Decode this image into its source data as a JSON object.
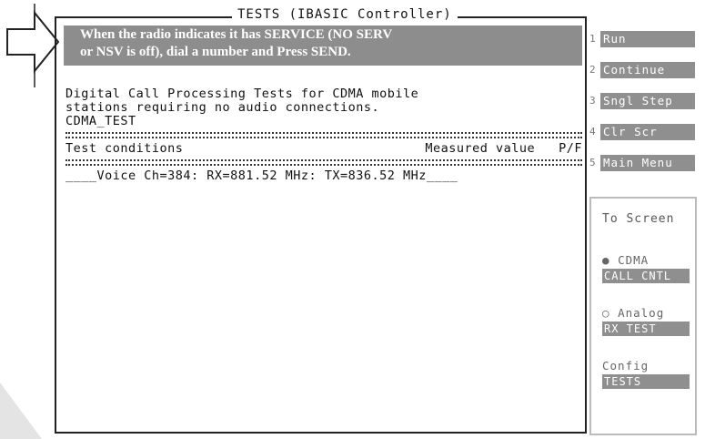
{
  "window": {
    "title": "TESTS (IBASIC Controller)"
  },
  "prompt": {
    "line1": "When the radio indicates it has SERVICE (NO SERV",
    "line2": "or NSV is off), dial a number and Press SEND."
  },
  "output": {
    "desc1": "Digital Call Processing Tests for CDMA mobile",
    "desc2": "stations requiring no audio connections.",
    "test_name": "CDMA_TEST",
    "col_conditions": "Test conditions",
    "col_measured": "Measured value",
    "col_pf": "P/F",
    "result_line": "____Voice Ch=384: RX=881.52 MHz: TX=836.52 MHz____"
  },
  "softkeys": [
    {
      "num": "1",
      "label": "Run"
    },
    {
      "num": "2",
      "label": "Continue"
    },
    {
      "num": "3",
      "label": "Sngl Step"
    },
    {
      "num": "4",
      "label": "Clr Scr"
    },
    {
      "num": "5",
      "label": "Main Menu"
    }
  ],
  "to_screen": {
    "title": "To Screen",
    "options": [
      {
        "radio": "●",
        "label": "CDMA",
        "target": "CALL CNTL"
      },
      {
        "radio": "○",
        "label": "Analog",
        "target": "RX TEST"
      },
      {
        "radio": "",
        "label": "Config",
        "target": "TESTS"
      }
    ]
  }
}
